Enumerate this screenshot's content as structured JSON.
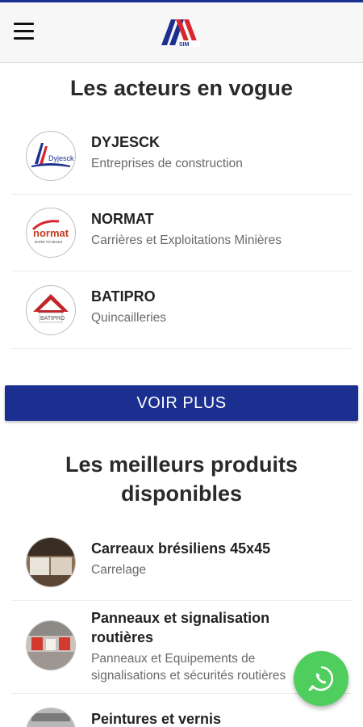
{
  "header": {
    "logo_text": "SIM",
    "menu_icon": "hamburger-menu-icon"
  },
  "actors": {
    "title": "Les acteurs en vogue",
    "items": [
      {
        "name": "DYJESCK",
        "category": "Entreprises de construction",
        "logo_text": "Dyjesck"
      },
      {
        "name": "NORMAT",
        "category": "Carrières et Exploitations Minières",
        "logo_text": "normat",
        "logo_tagline": "DARE TO BUILD"
      },
      {
        "name": "BATIPRO",
        "category": "Quincailleries",
        "logo_text": "BATIPRO"
      }
    ],
    "more_label": "VOIR PLUS"
  },
  "products": {
    "title": "Les meilleurs produits disponibles",
    "items": [
      {
        "name": "Carreaux brésiliens 45x45",
        "category": "Carrelage"
      },
      {
        "name": "Panneaux et signalisation routières",
        "category": "Panneaux et Equipements de signalisations et sécurités routières"
      },
      {
        "name": "Peintures et vernis",
        "category": ""
      }
    ]
  },
  "fab": {
    "icon": "whatsapp-icon"
  },
  "colors": {
    "brand_blue": "#1a2f8f",
    "brand_red": "#d8262e",
    "whatsapp_green": "#4fce5d"
  }
}
